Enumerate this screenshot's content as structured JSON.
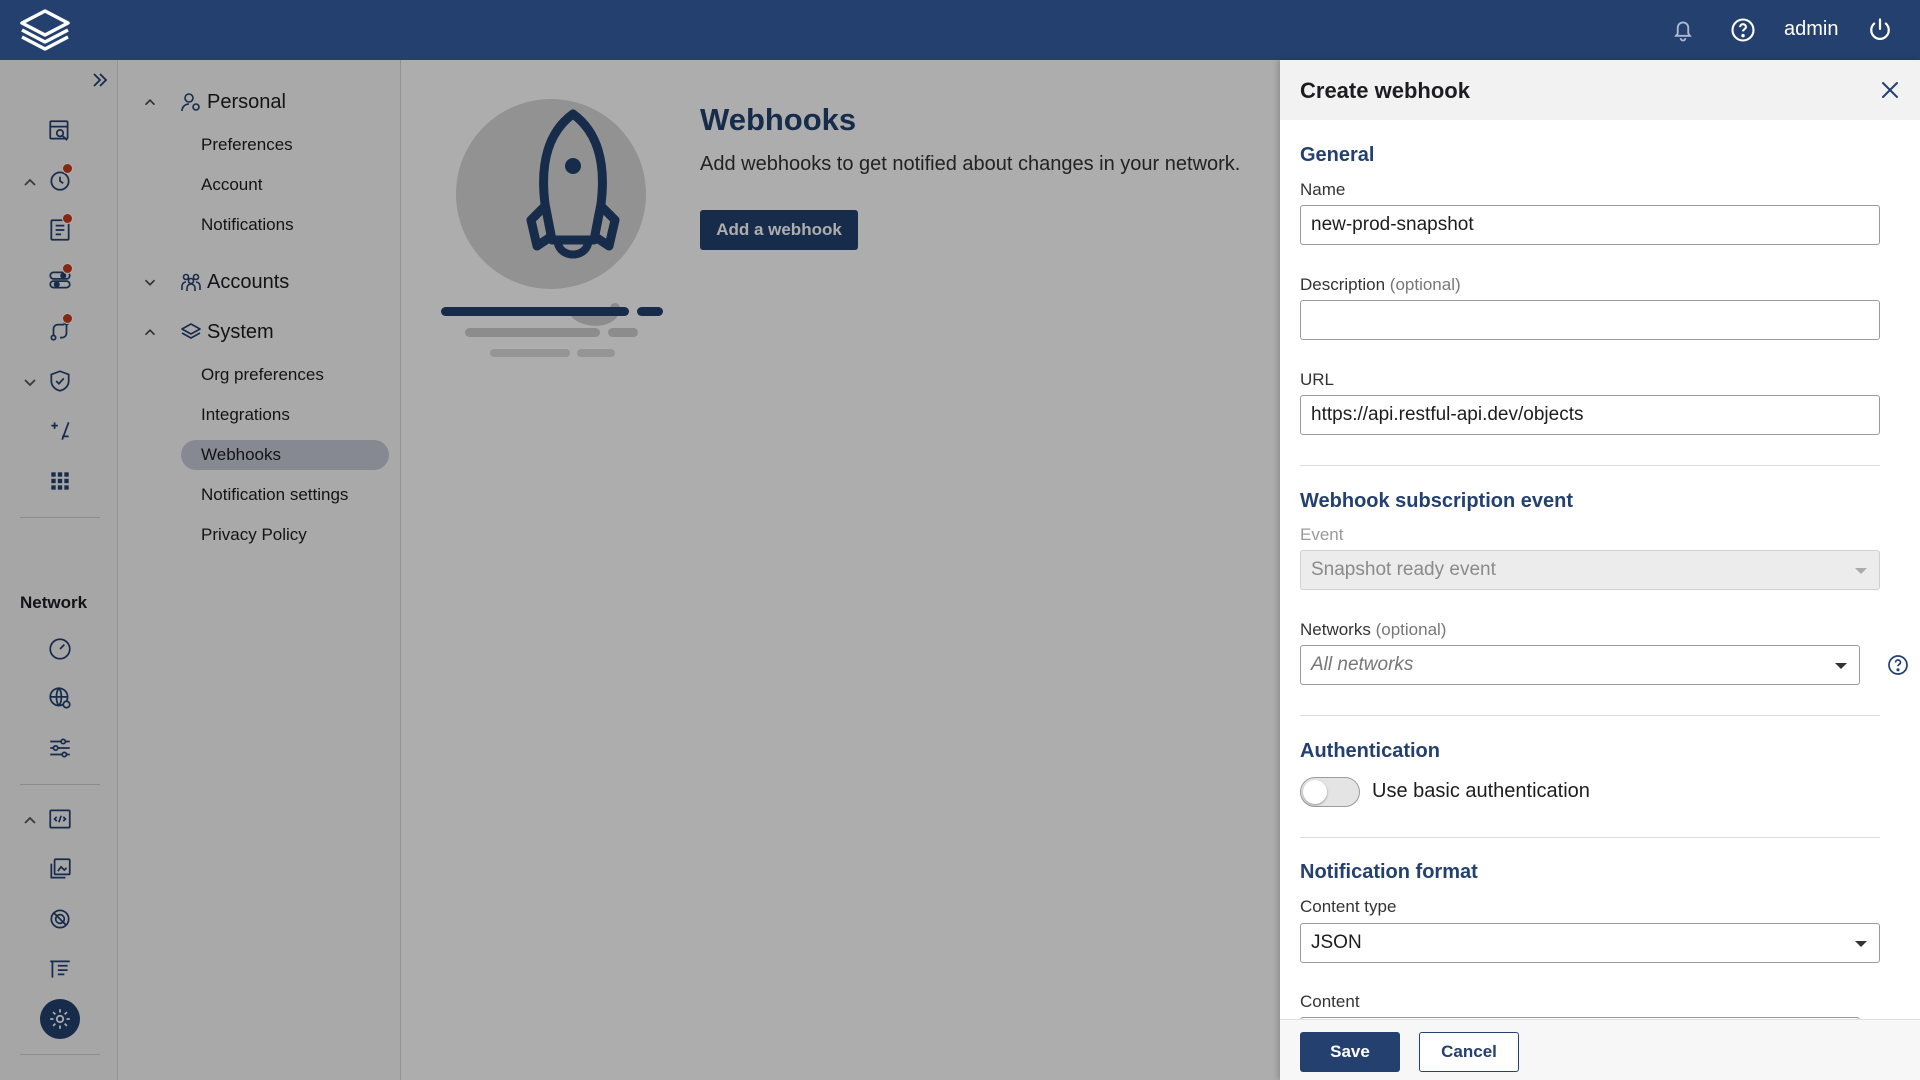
{
  "topbar": {
    "logo": "app-logo",
    "user": "admin",
    "icons": [
      "bell-icon",
      "help-circle-icon",
      "power-icon"
    ]
  },
  "rail": {
    "section_label": "Network",
    "icons": [
      "expand-sidebar-icon",
      "dashboard-search-icon",
      "alerts-icon",
      "reports-icon",
      "toggles-icon",
      "routes-icon",
      "shield-icon",
      "calculator-icon",
      "apps-grid-icon",
      "gauge-icon",
      "globe-settings-icon",
      "sliders-icon",
      "code-file-icon",
      "gallery-icon",
      "blocked-icon",
      "tasks-board-icon",
      "settings-icon",
      "book-icon"
    ]
  },
  "nav": {
    "groups": [
      {
        "label": "Personal",
        "items": [
          "Preferences",
          "Account",
          "Notifications"
        ]
      },
      {
        "label": "Accounts",
        "items": []
      },
      {
        "label": "System",
        "items": [
          "Org preferences",
          "Integrations",
          "Webhooks",
          "Notification settings",
          "Privacy Policy"
        ]
      }
    ],
    "active": "Webhooks"
  },
  "main": {
    "title": "Webhooks",
    "description": "Add webhooks to get notified about changes in your network.",
    "add_button": "Add a webhook"
  },
  "drawer": {
    "title": "Create webhook",
    "general": {
      "title": "General",
      "name_label": "Name",
      "name_value": "new-prod-snapshot",
      "description_label": "Description",
      "description_optional": "(optional)",
      "description_value": "",
      "url_label": "URL",
      "url_value": "https://api.restful-api.dev/objects"
    },
    "subscription": {
      "title": "Webhook subscription event",
      "event_label": "Event",
      "event_value": "Snapshot ready event",
      "networks_label": "Networks",
      "networks_optional": "(optional)",
      "networks_placeholder": "All networks"
    },
    "authentication": {
      "title": "Authentication",
      "toggle_label": "Use basic authentication",
      "enabled": false
    },
    "format": {
      "title": "Notification format",
      "content_type_label": "Content type",
      "content_type_value": "JSON",
      "content_label": "Content"
    },
    "footer": {
      "save": "Save",
      "cancel": "Cancel"
    }
  },
  "colors": {
    "brand": "#23406f",
    "notification_dot": "#c63a1e",
    "active_nav": "#c6cbd6"
  }
}
